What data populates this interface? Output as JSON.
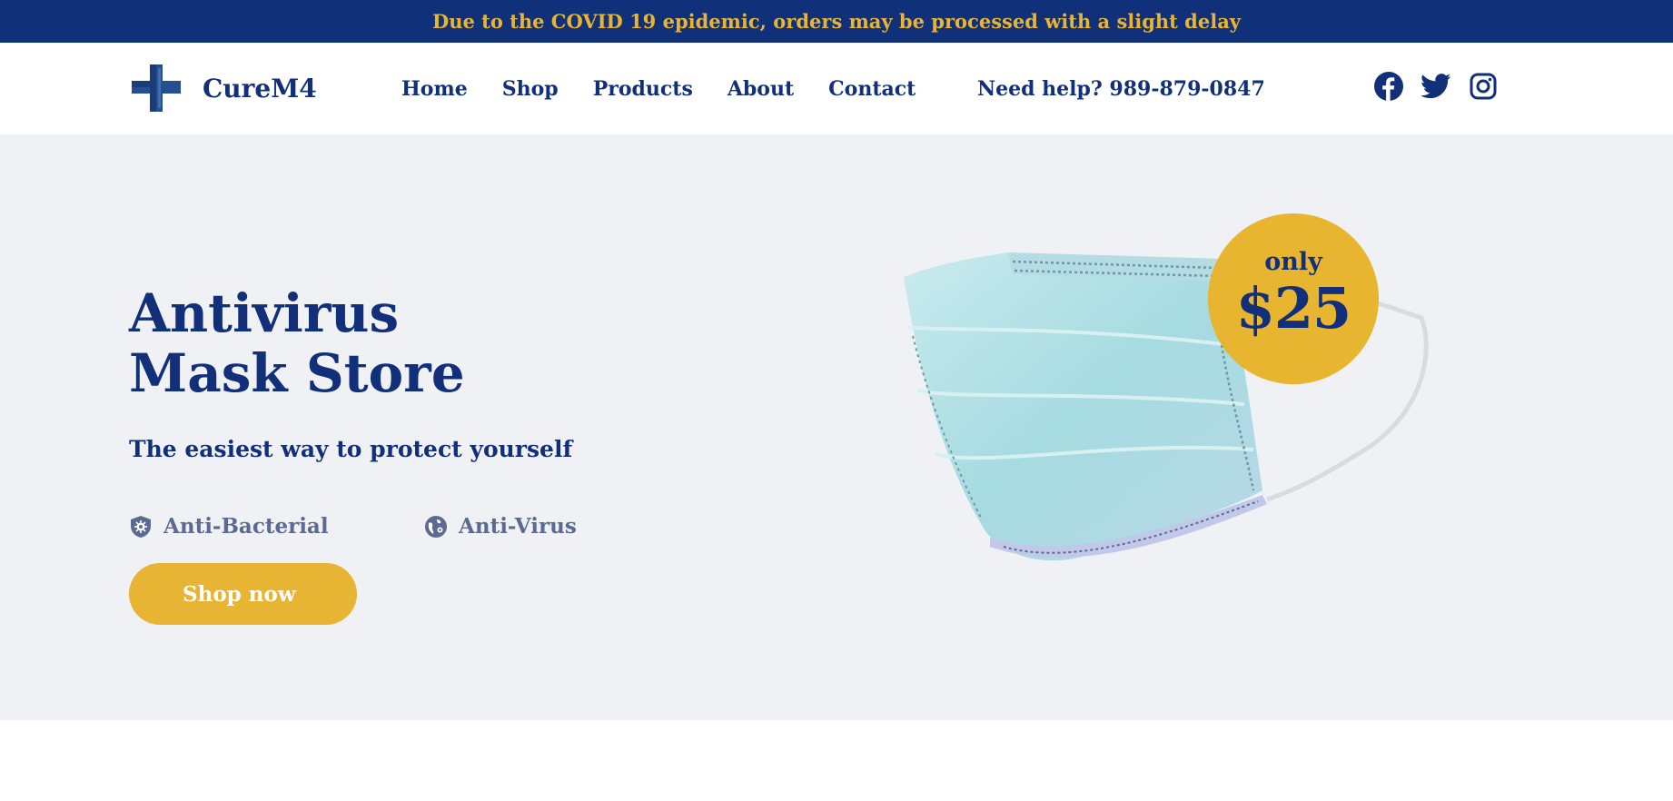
{
  "announcement": "Due to the COVID 19 epidemic, orders may be processed with a slight delay",
  "brand": {
    "name": "CureM4",
    "icon": "medical-cross-icon"
  },
  "nav": [
    {
      "label": "Home"
    },
    {
      "label": "Shop"
    },
    {
      "label": "Products"
    },
    {
      "label": "About"
    },
    {
      "label": "Contact"
    }
  ],
  "help": "Need help? 989-879-0847",
  "social": [
    {
      "icon": "facebook-icon"
    },
    {
      "icon": "twitter-icon"
    },
    {
      "icon": "instagram-icon"
    }
  ],
  "hero": {
    "title_line1": "Antivirus",
    "title_line2": "Mask Store",
    "subtitle": "The easiest way to protect yourself",
    "features": [
      {
        "label": "Anti-Bacterial",
        "icon": "shield-virus-icon"
      },
      {
        "label": "Anti-Virus",
        "icon": "globe-virus-icon"
      }
    ],
    "cta": "Shop now",
    "badge": {
      "only": "only",
      "price": "$25"
    },
    "image": "surgical-mask-image"
  },
  "colors": {
    "navy": "#10307a",
    "gold": "#e7b533",
    "hero_bg": "#f0f1f5",
    "muted": "#5b6a91"
  }
}
